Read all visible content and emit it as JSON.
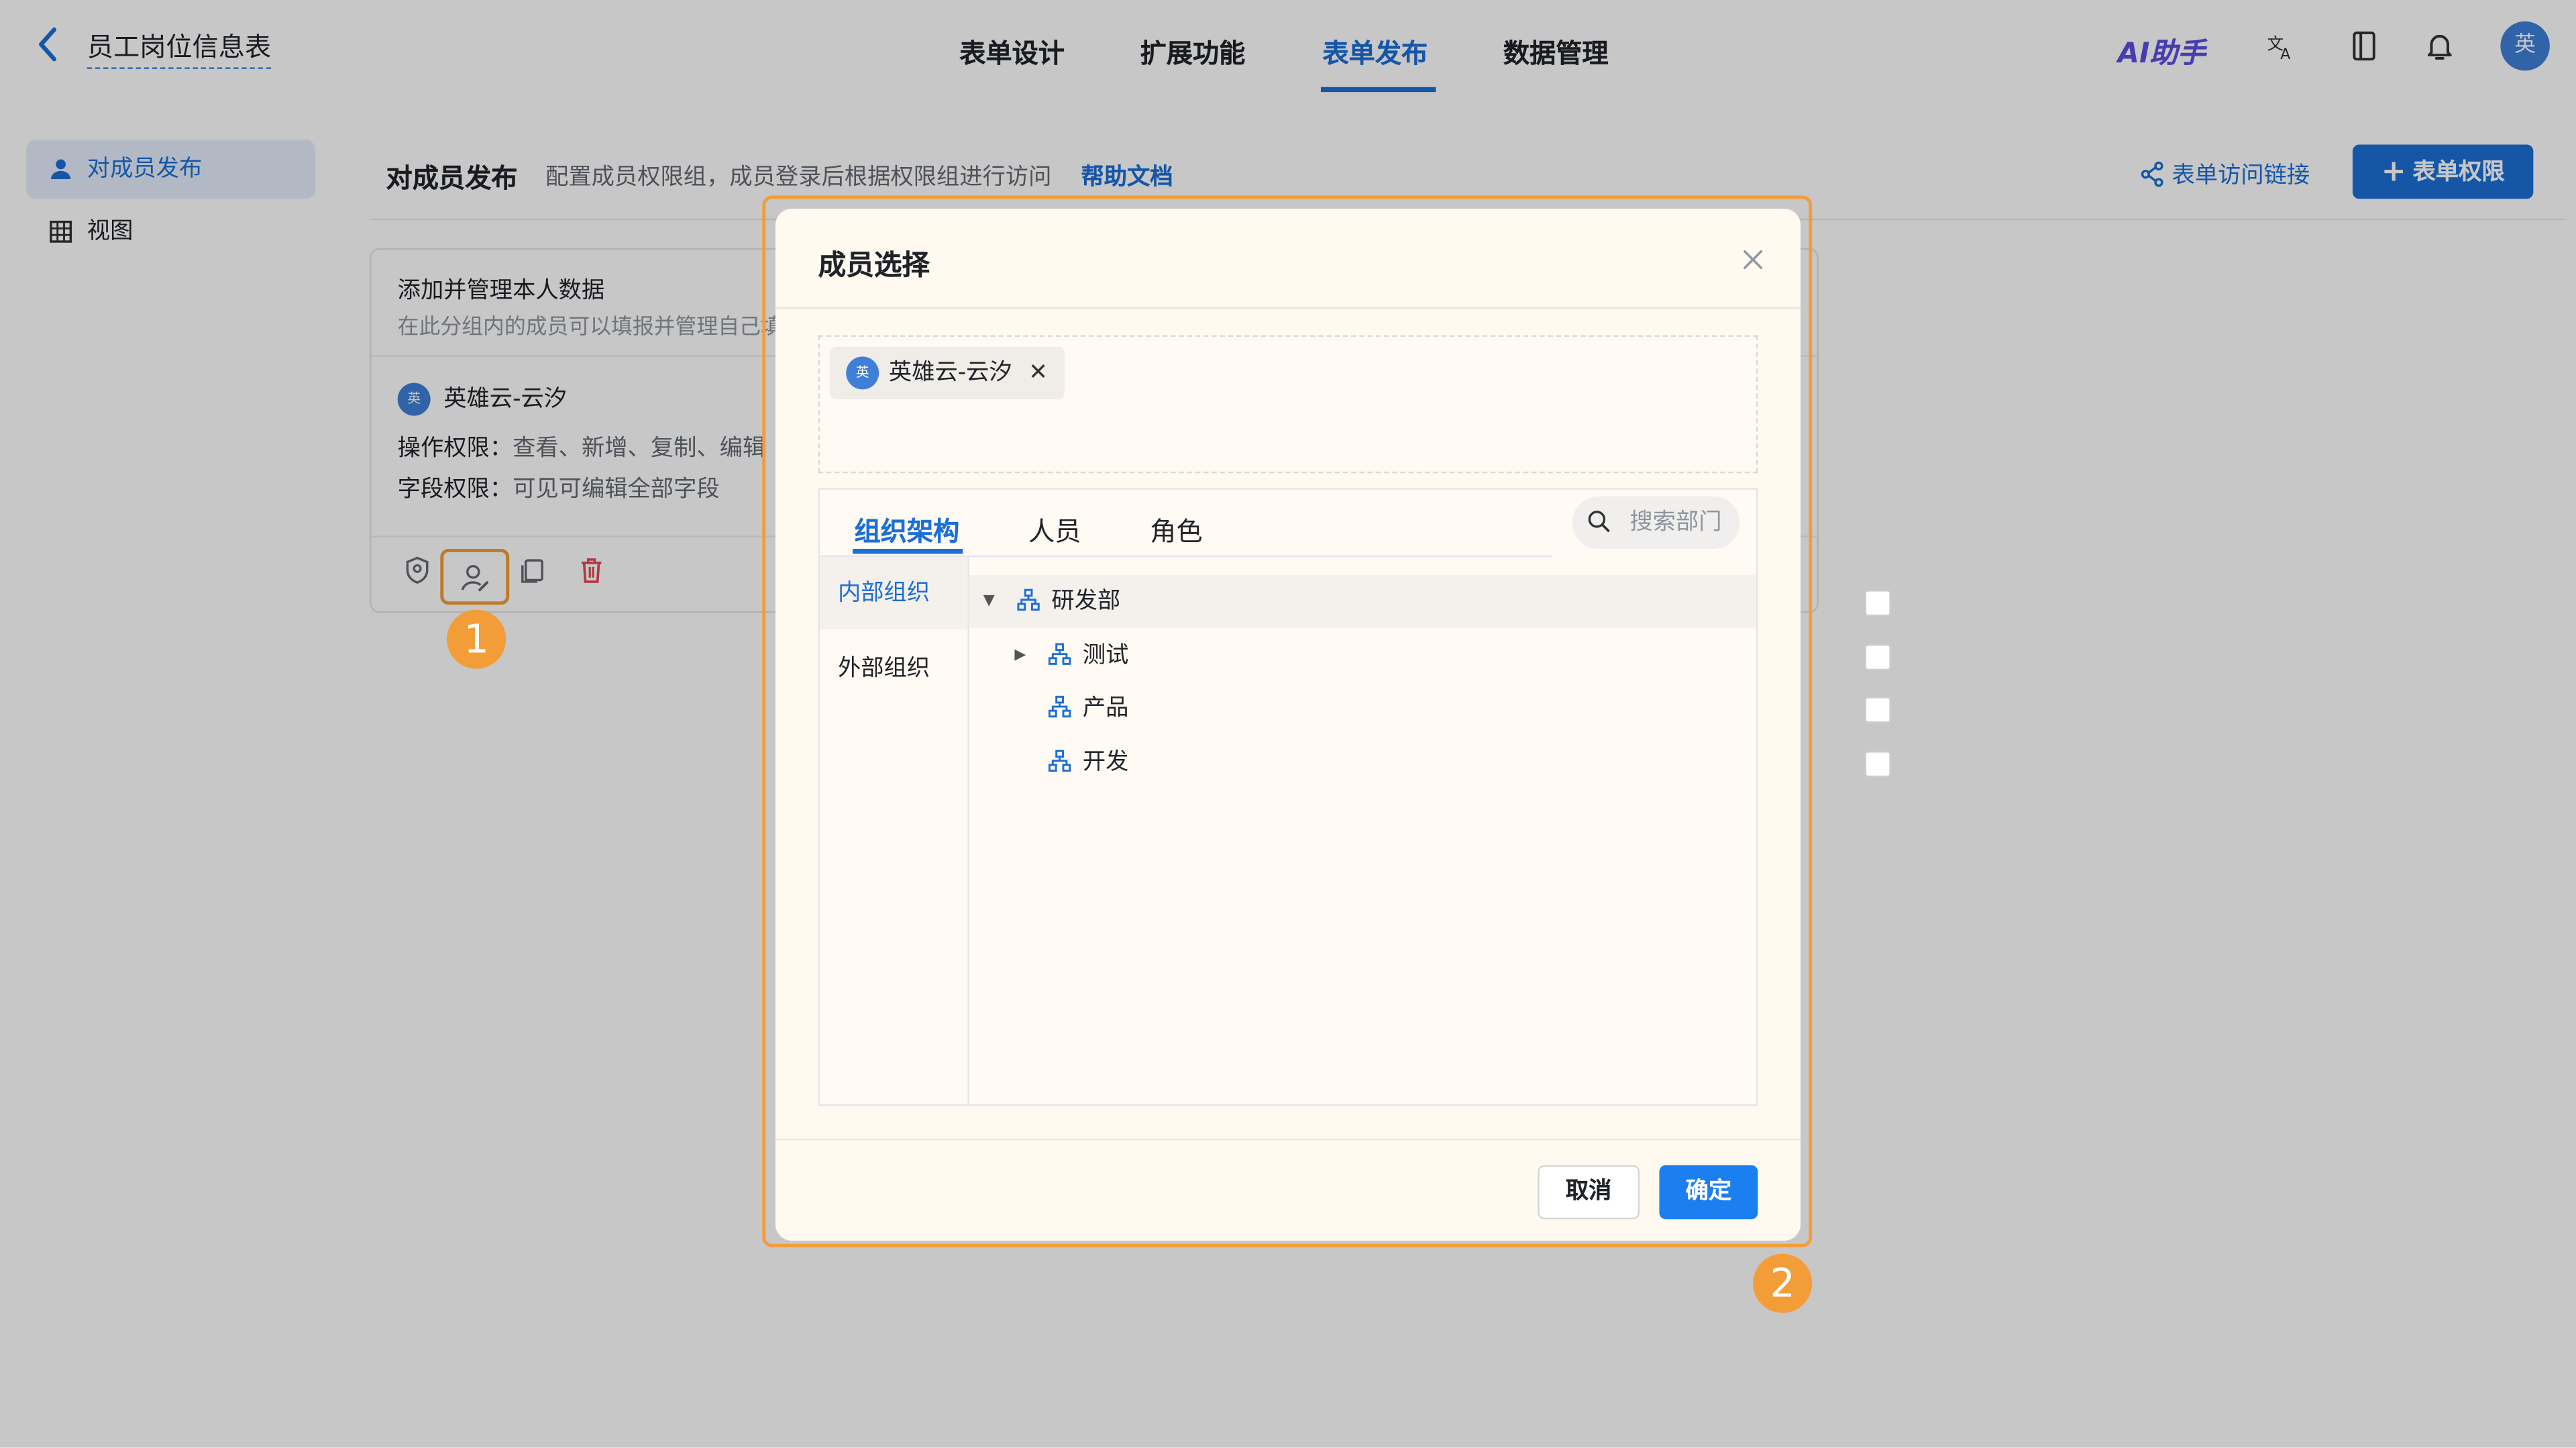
{
  "header": {
    "back_icon": "chevron-left-icon",
    "app_title": "员工岗位信息表",
    "tabs": [
      {
        "label": "表单设计"
      },
      {
        "label": "扩展功能"
      },
      {
        "label": "表单发布"
      },
      {
        "label": "数据管理"
      }
    ],
    "active_tab": "表单发布",
    "ai_label": "AI助手",
    "avatar_text": "英"
  },
  "sidebar": {
    "items": [
      {
        "label": "对成员发布",
        "icon": "person-icon"
      },
      {
        "label": "视图",
        "icon": "grid-icon"
      }
    ]
  },
  "main": {
    "title": "对成员发布",
    "description": "配置成员权限组，成员登录后根据权限组进行访问",
    "help_link": "帮助文档",
    "access_link": "表单访问链接",
    "add_permission": "表单权限",
    "card": {
      "title": "添加并管理本人数据",
      "subtitle": "在此分组内的成员可以填报并管理自己填",
      "member_avatar": "英",
      "member_name": "英雄云-云汐",
      "op_label": "操作权限：",
      "op_value": "查看、新增、复制、编辑",
      "field_label": "字段权限：",
      "field_value": "可见可编辑全部字段"
    }
  },
  "annotations": {
    "badge1": "1",
    "badge2": "2"
  },
  "modal": {
    "title": "成员选择",
    "selected": [
      {
        "avatar": "英",
        "name": "英雄云-云汐"
      }
    ],
    "tabs": [
      {
        "label": "组织架构"
      },
      {
        "label": "人员"
      },
      {
        "label": "角色"
      }
    ],
    "search_placeholder": "搜索部门",
    "left_nav": [
      {
        "label": "内部组织"
      },
      {
        "label": "外部组织"
      }
    ],
    "tree": [
      {
        "label": "研发部",
        "level": 0,
        "expanded": true
      },
      {
        "label": "测试",
        "level": 1,
        "expanded": false
      },
      {
        "label": "产品",
        "level": 1
      },
      {
        "label": "开发",
        "level": 1
      }
    ],
    "cancel": "取消",
    "confirm": "确定"
  },
  "colors": {
    "accent": "#1b6fd6",
    "highlight": "#f29d38",
    "danger": "#e5484d"
  }
}
